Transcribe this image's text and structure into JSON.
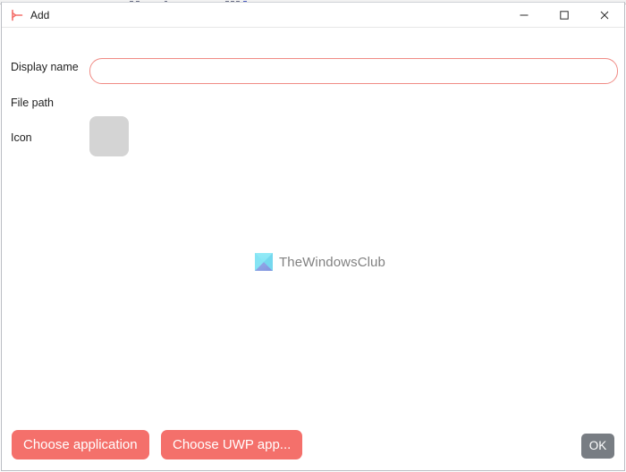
{
  "window": {
    "title": "Add",
    "app_icon": "pin-marker-icon",
    "accent_color": "#f4706b",
    "controls": [
      {
        "name": "minimize",
        "glyph": "—"
      },
      {
        "name": "maximize",
        "glyph": "□"
      },
      {
        "name": "close",
        "glyph": "✕"
      }
    ]
  },
  "form": {
    "display_name": {
      "label": "Display name",
      "value": "",
      "placeholder": "",
      "border_color": "#f08b85"
    },
    "file_path": {
      "label": "File path",
      "value": ""
    },
    "icon": {
      "label": "Icon",
      "preview_color": "#d4d4d4",
      "preview_value": ""
    }
  },
  "watermark": {
    "text": "TheWindowsClub",
    "logo": "thewindowsclub-logo-icon",
    "text_color": "#7b7b7b"
  },
  "footer": {
    "choose_application_label": "Choose application",
    "choose_uwp_label": "Choose UWP app...",
    "ok_label": "OK",
    "primary_button_color": "#f4706b",
    "ok_button_color": "#787d83"
  }
}
